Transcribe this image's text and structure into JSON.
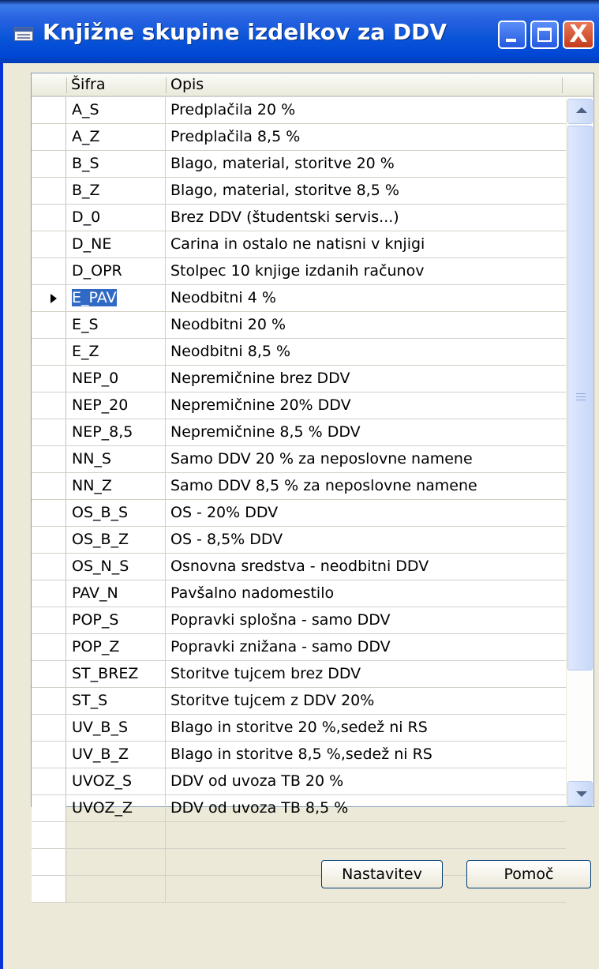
{
  "window": {
    "title": "Knjižne skupine izdelkov za DDV"
  },
  "titlebar_controls": {
    "minimize": "minimize-icon",
    "maximize": "maximize-icon",
    "close_glyph": "X"
  },
  "grid": {
    "columns": [
      "Šifra",
      "Opis"
    ],
    "selected_index": 7,
    "rows": [
      {
        "code": "A_S",
        "desc": "Predplačila 20 %"
      },
      {
        "code": "A_Z",
        "desc": "Predplačila  8,5 %"
      },
      {
        "code": "B_S",
        "desc": "Blago, material, storitve 20 %"
      },
      {
        "code": "B_Z",
        "desc": "Blago, material, storitve 8,5 %"
      },
      {
        "code": "D_0",
        "desc": "Brez DDV (študentski servis...)"
      },
      {
        "code": "D_NE",
        "desc": "Carina in ostalo ne natisni v knjigi"
      },
      {
        "code": "D_OPR",
        "desc": "Stolpec 10 knjige izdanih računov"
      },
      {
        "code": "E_PAV",
        "desc": "Neodbitni 4 %"
      },
      {
        "code": "E_S",
        "desc": "Neodbitni 20 %"
      },
      {
        "code": "E_Z",
        "desc": "Neodbitni 8,5 %"
      },
      {
        "code": "NEP_0",
        "desc": "Nepremičnine brez DDV"
      },
      {
        "code": "NEP_20",
        "desc": "Nepremičnine 20% DDV"
      },
      {
        "code": "NEP_8,5",
        "desc": "Nepremičnine 8,5 % DDV"
      },
      {
        "code": "NN_S",
        "desc": "Samo DDV 20 % za neposlovne namene"
      },
      {
        "code": "NN_Z",
        "desc": "Samo DDV 8,5 % za neposlovne namene"
      },
      {
        "code": "OS_B_S",
        "desc": "OS - 20% DDV"
      },
      {
        "code": "OS_B_Z",
        "desc": "OS - 8,5% DDV"
      },
      {
        "code": "OS_N_S",
        "desc": "Osnovna sredstva - neodbitni DDV"
      },
      {
        "code": "PAV_N",
        "desc": "Pavšalno nadomestilo"
      },
      {
        "code": "POP_S",
        "desc": "Popravki splošna - samo DDV"
      },
      {
        "code": "POP_Z",
        "desc": "Popravki znižana - samo DDV"
      },
      {
        "code": "ST_BREZ",
        "desc": "Storitve tujcem brez DDV"
      },
      {
        "code": "ST_S",
        "desc": "Storitve tujcem z DDV 20%"
      },
      {
        "code": "UV_B_S",
        "desc": "Blago in storitve 20 %,sedež ni RS"
      },
      {
        "code": "UV_B_Z",
        "desc": "Blago in storitve 8,5 %,sedež ni RS"
      },
      {
        "code": "UVOZ_S",
        "desc": "DDV od uvoza TB 20 %"
      },
      {
        "code": "UVOZ_Z",
        "desc": "DDV od uvoza TB 8,5 %"
      },
      {
        "code": "",
        "desc": ""
      },
      {
        "code": "",
        "desc": ""
      },
      {
        "code": "",
        "desc": ""
      }
    ]
  },
  "buttons": {
    "setup": "Nastavitev",
    "help": "Pomoč"
  },
  "colors": {
    "title_bar": "#0a55d8",
    "selection": "#316ac5",
    "close_button": "#c43c1c"
  }
}
